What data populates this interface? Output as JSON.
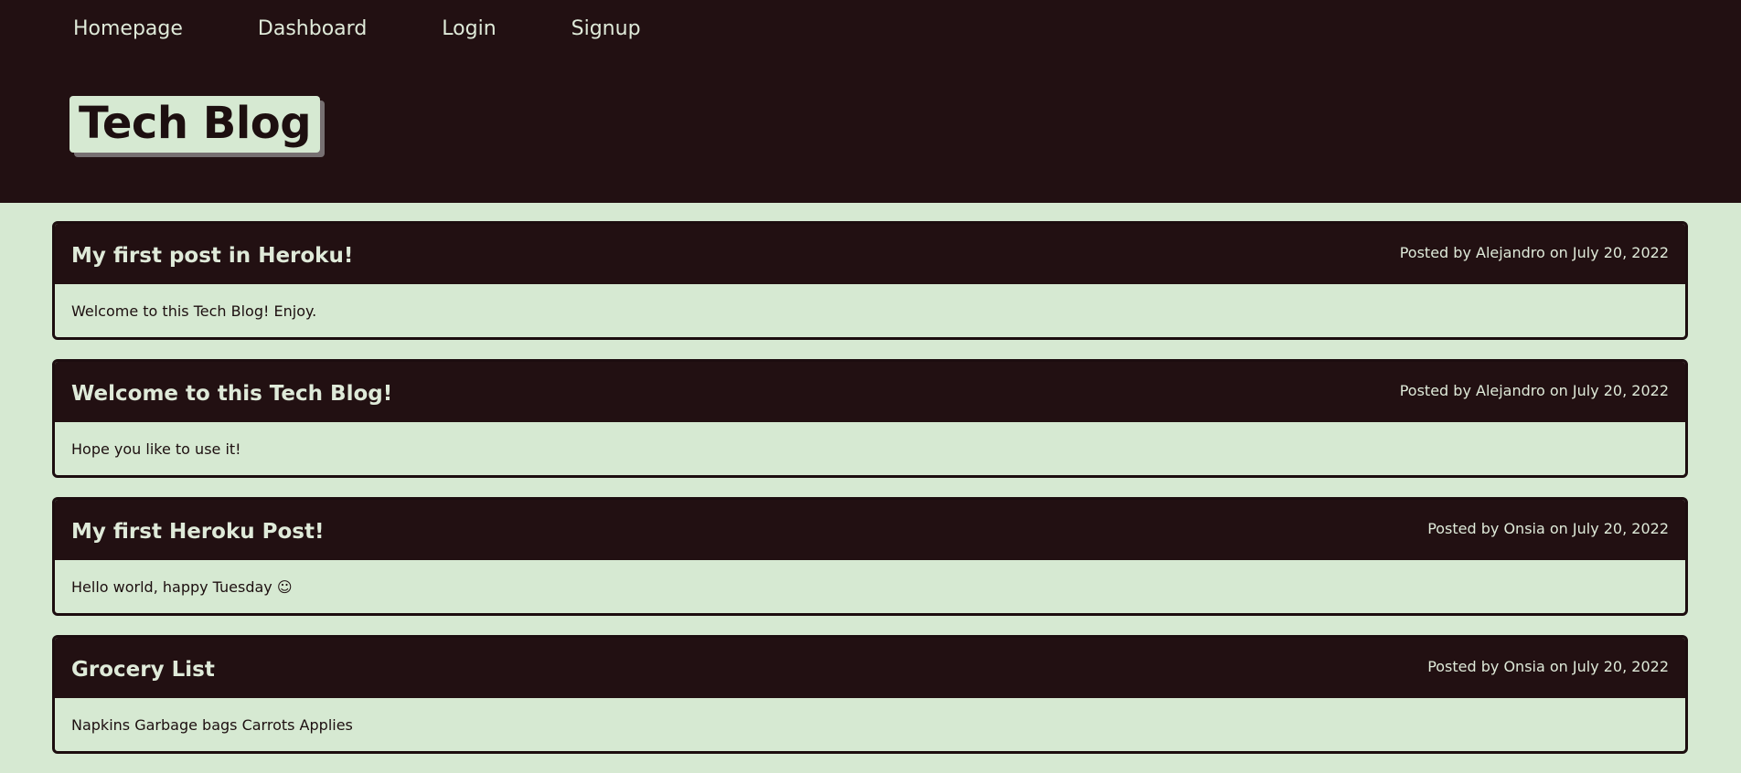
{
  "nav": {
    "items": [
      {
        "label": "Homepage"
      },
      {
        "label": "Dashboard"
      },
      {
        "label": "Login"
      },
      {
        "label": "Signup"
      }
    ]
  },
  "brand": {
    "title": "Tech Blog"
  },
  "posts": [
    {
      "title": "My first post in Heroku!",
      "meta": "Posted by Alejandro on July 20, 2022",
      "body": "Welcome to this Tech Blog! Enjoy."
    },
    {
      "title": "Welcome to this Tech Blog!",
      "meta": "Posted by Alejandro on July 20, 2022",
      "body": "Hope you like to use it!"
    },
    {
      "title": "My first Heroku Post!",
      "meta": "Posted by Onsia on July 20, 2022",
      "body": "Hello world, happy Tuesday ☺"
    },
    {
      "title": "Grocery List",
      "meta": "Posted by Onsia on July 20, 2022",
      "body": "Napkins Garbage bags Carrots Applies"
    }
  ],
  "colors": {
    "header_bg": "#221012",
    "page_bg": "#d6e9d2",
    "text_light": "#dfead9",
    "text_dark": "#1d0f10"
  }
}
